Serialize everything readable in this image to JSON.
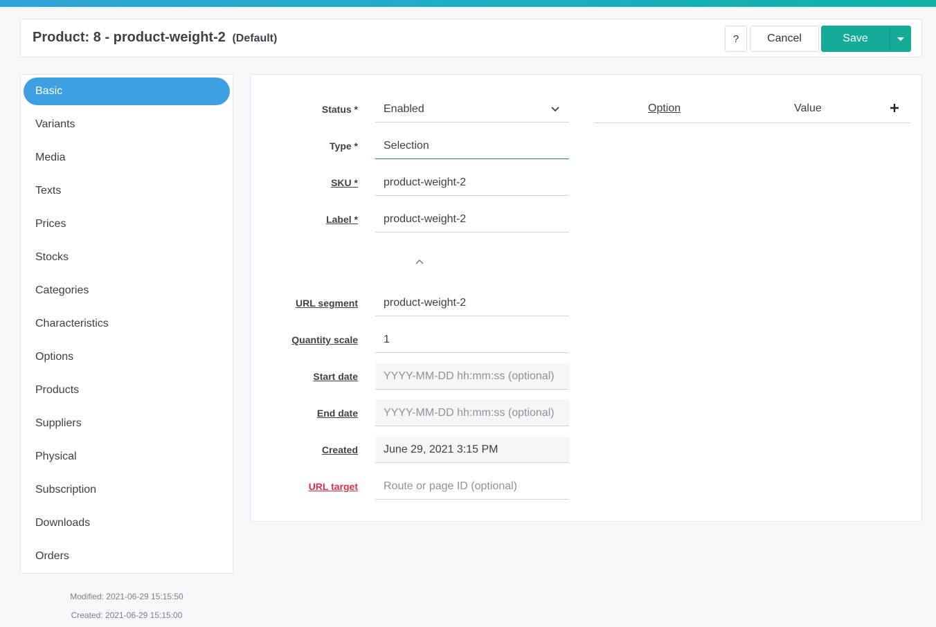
{
  "header": {
    "title": "Product: 8 - product-weight-2",
    "subtitle": "(Default)",
    "help_label": "?",
    "cancel_label": "Cancel",
    "save_label": "Save"
  },
  "nav": {
    "items": [
      {
        "label": "Basic",
        "active": true
      },
      {
        "label": "Variants"
      },
      {
        "label": "Media"
      },
      {
        "label": "Texts"
      },
      {
        "label": "Prices"
      },
      {
        "label": "Stocks"
      },
      {
        "label": "Categories"
      },
      {
        "label": "Characteristics"
      },
      {
        "label": "Options"
      },
      {
        "label": "Products"
      },
      {
        "label": "Suppliers"
      },
      {
        "label": "Physical"
      },
      {
        "label": "Subscription"
      },
      {
        "label": "Downloads"
      },
      {
        "label": "Orders"
      }
    ]
  },
  "meta": {
    "modified": "Modified: 2021-06-29 15:15:50",
    "created": "Created: 2021-06-29 15:15:00"
  },
  "form": {
    "status": {
      "label": "Status *",
      "value": "Enabled"
    },
    "type": {
      "label": "Type *",
      "value": "Selection"
    },
    "sku": {
      "label": "SKU *",
      "value": "product-weight-2"
    },
    "label": {
      "label": "Label *",
      "value": "product-weight-2"
    },
    "url_segment": {
      "label": "URL segment",
      "value": "product-weight-2"
    },
    "quantity_scale": {
      "label": "Quantity scale",
      "value": "1"
    },
    "start_date": {
      "label": "Start date",
      "placeholder": "YYYY-MM-DD hh:mm:ss (optional)"
    },
    "end_date": {
      "label": "End date",
      "placeholder": "YYYY-MM-DD hh:mm:ss (optional)"
    },
    "created": {
      "label": "Created",
      "value": "June 29, 2021 3:15 PM"
    },
    "url_target": {
      "label": "URL target",
      "placeholder": "Route or page ID (optional)"
    }
  },
  "options_table": {
    "col_option": "Option",
    "col_value": "Value"
  },
  "colors": {
    "accent": "#3da0e0",
    "save": "#14ab98",
    "error": "#d9304a"
  }
}
